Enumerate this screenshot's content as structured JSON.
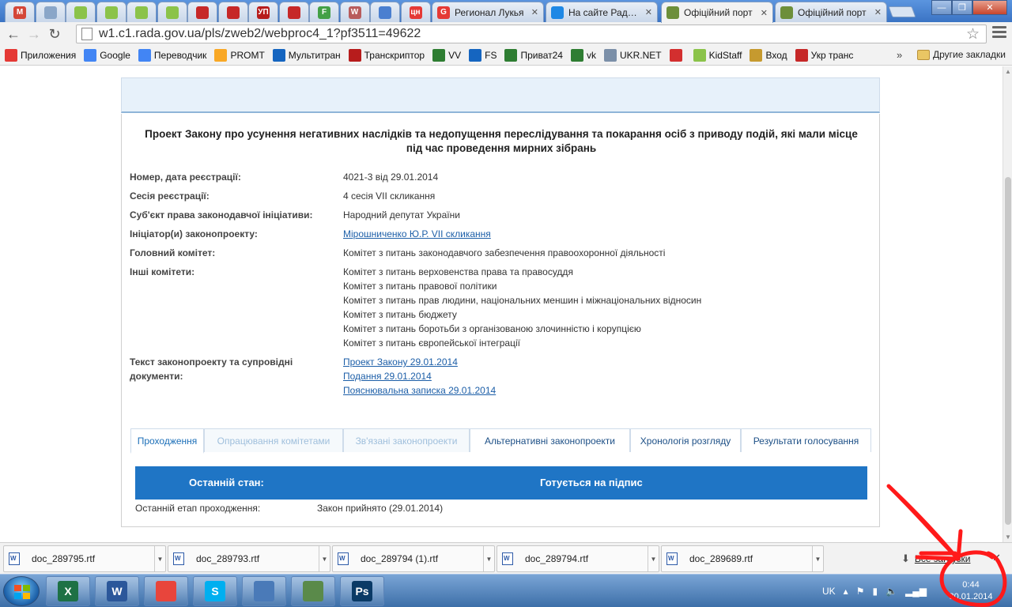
{
  "browser": {
    "pinned_tabs": [
      {
        "icon": "gmail-icon",
        "glyph": "M",
        "color": "#d44638"
      },
      {
        "icon": "ukrnet-icon",
        "glyph": "",
        "color": "#8aa6c8"
      },
      {
        "icon": "kidstaff-icon",
        "glyph": "",
        "color": "#8bc34a"
      },
      {
        "icon": "kidstaff-icon",
        "glyph": "",
        "color": "#8bc34a"
      },
      {
        "icon": "kidstaff-icon",
        "glyph": "",
        "color": "#8bc34a"
      },
      {
        "icon": "kidstaff-icon",
        "glyph": "",
        "color": "#8bc34a"
      },
      {
        "icon": "cart-icon",
        "glyph": "",
        "color": "#c62828"
      },
      {
        "icon": "cart-icon",
        "glyph": "",
        "color": "#c62828"
      },
      {
        "icon": "up-icon",
        "glyph": "УП",
        "color": "#b71c1c"
      },
      {
        "icon": "cart-icon",
        "glyph": "",
        "color": "#c62828"
      },
      {
        "icon": "f-icon",
        "glyph": "F",
        "color": "#43a047"
      },
      {
        "icon": "w-icon",
        "glyph": "W",
        "color": "#b85c5c"
      },
      {
        "icon": "puzzle-icon",
        "glyph": "",
        "color": "#4a7fd0"
      },
      {
        "icon": "cn-icon",
        "glyph": "цн",
        "color": "#e53935"
      }
    ],
    "tabs": [
      {
        "label": "Регионал Лукья",
        "icon": "g-icon",
        "glyph": "G",
        "color": "#e53935"
      },
      {
        "label": "На сайте Рады о",
        "icon": "flag-icon",
        "glyph": "",
        "color": "#1e88e5"
      },
      {
        "label": "Офіційний порт",
        "icon": "rada-icon",
        "glyph": "",
        "color": "#6d8f3a",
        "active": true
      },
      {
        "label": "Офіційний порт",
        "icon": "rada-icon",
        "glyph": "",
        "color": "#6d8f3a"
      }
    ],
    "url": "w1.c1.rada.gov.ua/pls/zweb2/webproc4_1?pf3511=49622",
    "bookmarks": [
      {
        "label": "Приложения",
        "icon": "apps-icon",
        "color": "#e53935"
      },
      {
        "label": "Google",
        "icon": "google-icon",
        "color": "#4285f4"
      },
      {
        "label": "Переводчик",
        "icon": "translate-icon",
        "color": "#4285f4"
      },
      {
        "label": "PROMT",
        "icon": "promt-icon",
        "color": "#f9a825"
      },
      {
        "label": "Мультитран",
        "icon": "multitran-icon",
        "color": "#1565c0"
      },
      {
        "label": "Транскриптор",
        "icon": "transcriptor-icon",
        "color": "#b71c1c"
      },
      {
        "label": "VV",
        "icon": "vv-icon",
        "color": "#2e7d32"
      },
      {
        "label": "FS",
        "icon": "fs-arrow-icon",
        "color": "#1565c0"
      },
      {
        "label": "Приват24",
        "icon": "privat-icon",
        "color": "#2e7d32"
      },
      {
        "label": "vk",
        "icon": "vk-icon",
        "color": "#2e7d32"
      },
      {
        "label": "UKR.NET",
        "icon": "ukrnet-icon",
        "color": "#7b8fa8"
      },
      {
        "label": "",
        "icon": "youtube-icon",
        "color": "#d32f2f"
      },
      {
        "label": "KidStaff",
        "icon": "kidstaff-icon",
        "color": "#8bc34a"
      },
      {
        "label": "Вход",
        "icon": "key-icon",
        "color": "#c69a2f"
      },
      {
        "label": "Укр транс",
        "icon": "ukrtrans-icon",
        "color": "#c62828"
      }
    ],
    "more": "»",
    "other_bookmarks": "Другие закладки"
  },
  "bill": {
    "title": "Проект Закону про усунення негативних наслідків та недопущення переслідування та покарання осіб з приводу подій, які мали місце під час проведення мирних зібрань",
    "fields": [
      {
        "label": "Номер, дата реєстрації:",
        "value": "4021-3 від 29.01.2014"
      },
      {
        "label": "Сесія реєстрації:",
        "value": "4 сесія VII скликання"
      },
      {
        "label": "Суб'єкт права законодавчої ініціативи:",
        "value": "Народний депутат України"
      },
      {
        "label": "Ініціатор(и) законопроекту:",
        "value": "Мірошниченко Ю.Р. VII скликання "
      },
      {
        "label": "Головний комітет:",
        "value": "Комітет з питань законодавчого забезпечення правоохоронної діяльності"
      }
    ],
    "other_committees_label": "Інші комітети:",
    "other_committees": [
      "Комітет з питань верховенства права та правосуддя",
      "Комітет з питань правової політики",
      "Комітет з питань прав людини, національних меншин і міжнаціональних відносин",
      "Комітет з питань бюджету",
      "Комітет з питань боротьби з організованою злочинністю і корупцією",
      "Комітет з питань європейської інтеграції"
    ],
    "docs_label_1": "Текст законопроекту та супровідні",
    "docs_label_2": "документи:",
    "docs": [
      "Проект Закону 29.01.2014",
      "Подання 29.01.2014",
      "Пояснювальна записка 29.01.2014"
    ],
    "tabs": [
      {
        "label": "Проходження",
        "state": "active"
      },
      {
        "label": "Опрацювання комітетами",
        "state": "dim"
      },
      {
        "label": "Зв'язані законопроекти",
        "state": "dim"
      },
      {
        "label": "Альтернативні законопроекти",
        "state": "normal"
      },
      {
        "label": "Хронологія розгляду",
        "state": "normal"
      },
      {
        "label": "Результати голосування",
        "state": "normal"
      }
    ],
    "last_state_label": "Останній стан:",
    "last_state_value": "Готується на підпис",
    "last_stage_label": "Останній етап проходження:",
    "last_stage_value": "Закон прийнято (29.01.2014)"
  },
  "downloads": {
    "items": [
      "doc_289795.rtf",
      "doc_289793.rtf",
      "doc_289794 (1).rtf",
      "doc_289794.rtf",
      "doc_289689.rtf"
    ],
    "all_label": "Все загрузки"
  },
  "taskbar": {
    "apps": [
      {
        "icon": "excel-icon",
        "glyph": "X",
        "color": "#1e7145"
      },
      {
        "icon": "word-icon",
        "glyph": "W",
        "color": "#2b579a"
      },
      {
        "icon": "chrome-icon",
        "glyph": "",
        "color": "#e8453c"
      },
      {
        "icon": "skype-icon",
        "glyph": "S",
        "color": "#00aff0"
      },
      {
        "icon": "explorer-icon",
        "glyph": "",
        "color": "#4a7ab8"
      },
      {
        "icon": "monitor-icon",
        "glyph": "",
        "color": "#5a8a4a"
      },
      {
        "icon": "photoshop-icon",
        "glyph": "Ps",
        "color": "#0a3a66"
      }
    ],
    "lang": "UK",
    "time": "0:44",
    "date": "30.01.2014"
  },
  "colors": {
    "annotation": "#ff1a1a",
    "state_bar": "#1f75c5",
    "link": "#1d5fa8"
  }
}
